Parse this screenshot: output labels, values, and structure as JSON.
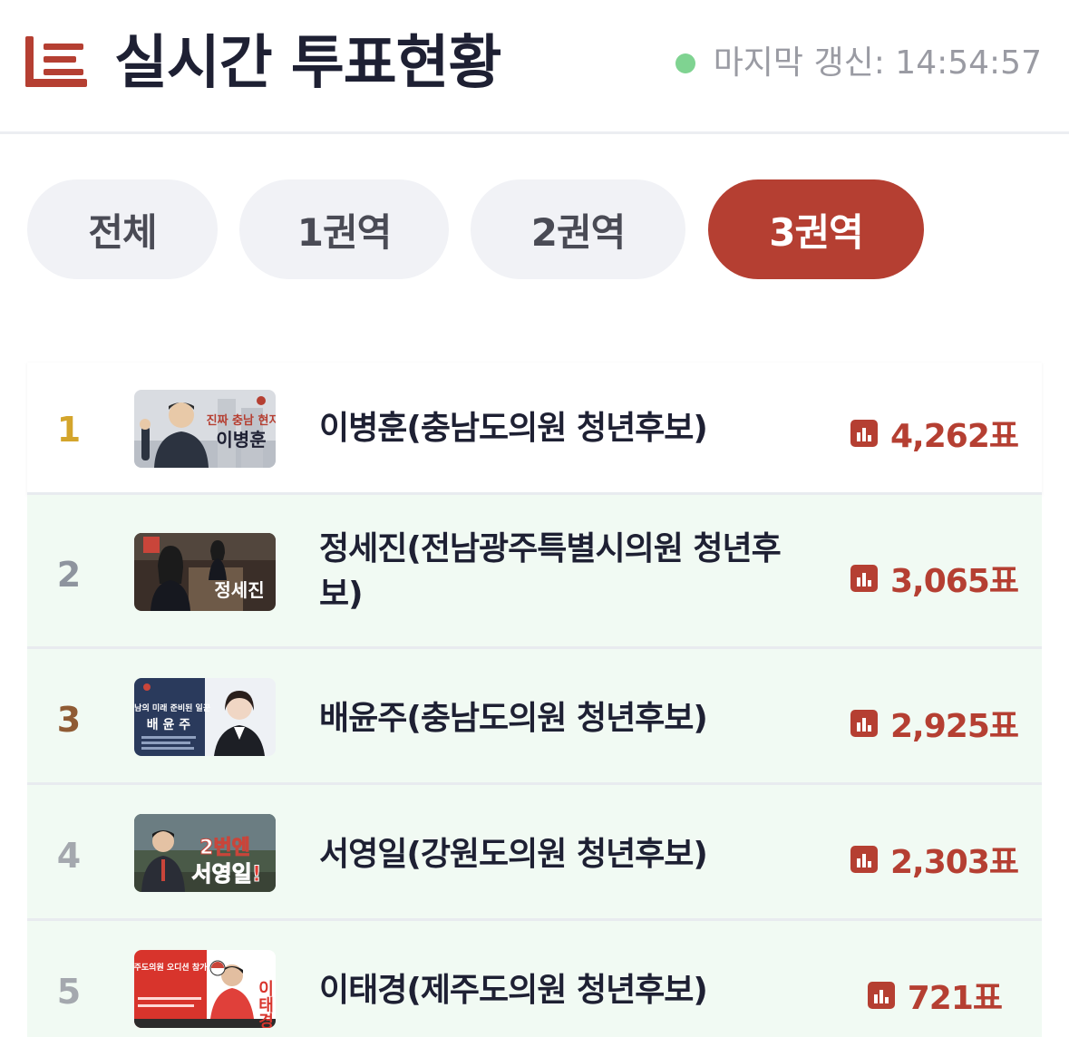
{
  "header": {
    "title": "실시간 투표현황",
    "last_update_label": "마지막 갱신: 14:54:57"
  },
  "tabs": [
    {
      "label": "전체",
      "active": false
    },
    {
      "label": "1권역",
      "active": false
    },
    {
      "label": "2권역",
      "active": false
    },
    {
      "label": "3권역",
      "active": true
    }
  ],
  "candidates": [
    {
      "rank": "1",
      "name": "이병훈(충남도의원 청년후보)",
      "votes": "4,262표",
      "thumb_caption": "이병훈",
      "thumb_slogan": "진짜 충남 현지인"
    },
    {
      "rank": "2",
      "name": "정세진(전남광주특별시의원 청년후보)",
      "votes": "3,065표",
      "thumb_caption": "정세진",
      "thumb_slogan": ""
    },
    {
      "rank": "3",
      "name": "배윤주(충남도의원 청년후보)",
      "votes": "2,925표",
      "thumb_caption": "배 윤 주",
      "thumb_slogan": "충남의 미래 준비된 일꾼"
    },
    {
      "rank": "4",
      "name": "서영일(강원도의원 청년후보)",
      "votes": "2,303표",
      "thumb_caption": "서영일!",
      "thumb_slogan": "2번엔"
    },
    {
      "rank": "5",
      "name": "이태경(제주도의원 청년후보)",
      "votes": "721표",
      "thumb_caption": "이태경",
      "thumb_slogan": "제주도의원 오디션 참가자"
    }
  ],
  "colors": {
    "accent": "#b53f32",
    "rank_gold": "#d4a52c",
    "rank_silver": "#8e949e",
    "rank_bronze": "#8f5b34",
    "rank_other": "#a4a8ae",
    "status_online": "#7fd391"
  },
  "icons": {
    "logo": "ranking-list-icon",
    "vote": "bar-chart-icon"
  }
}
